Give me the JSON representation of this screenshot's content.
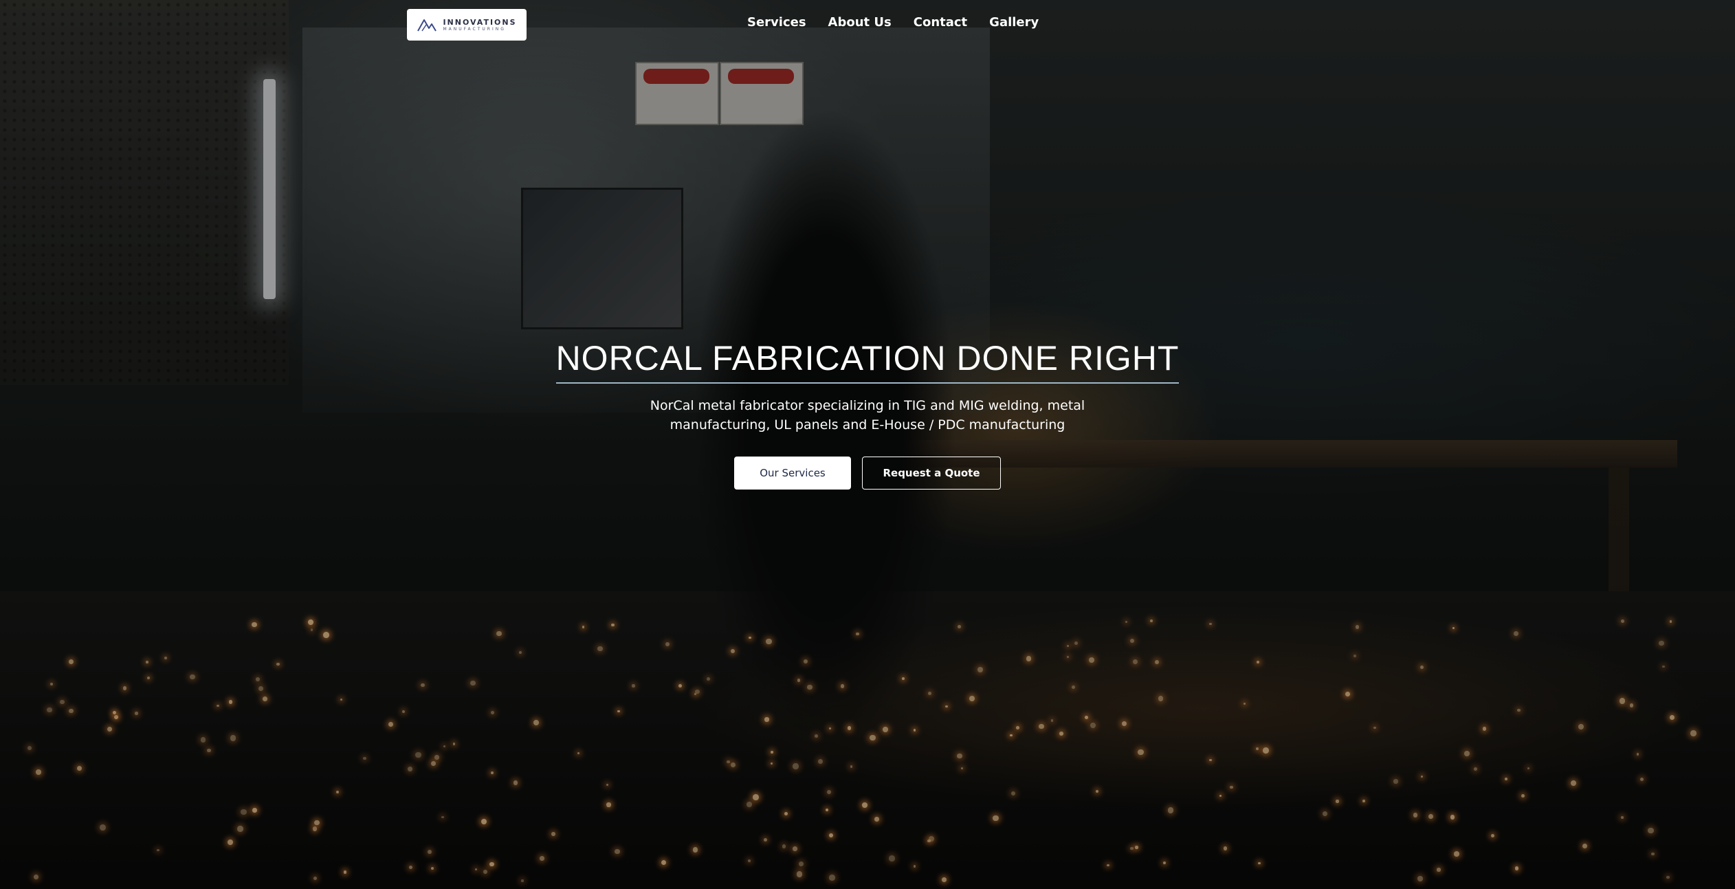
{
  "header": {
    "logo": {
      "title": "INNOVATIONS",
      "subtitle": "MANUFACTURING",
      "icon": "mountain-logo-icon"
    },
    "nav": [
      {
        "label": "Services"
      },
      {
        "label": "About Us"
      },
      {
        "label": "Contact"
      },
      {
        "label": "Gallery"
      }
    ]
  },
  "hero": {
    "title": "NORCAL FABRICATION DONE RIGHT",
    "subtitle": "NorCal metal fabricator specializing in TIG and MIG welding, metal manufacturing, UL panels and E-House / PDC manufacturing",
    "buttons": {
      "primary": "Our Services",
      "secondary": "Request a Quote"
    }
  },
  "colors": {
    "brand_navy": "#1c2748",
    "text_white": "#ffffff",
    "title_underline": "#9fb8c8"
  }
}
